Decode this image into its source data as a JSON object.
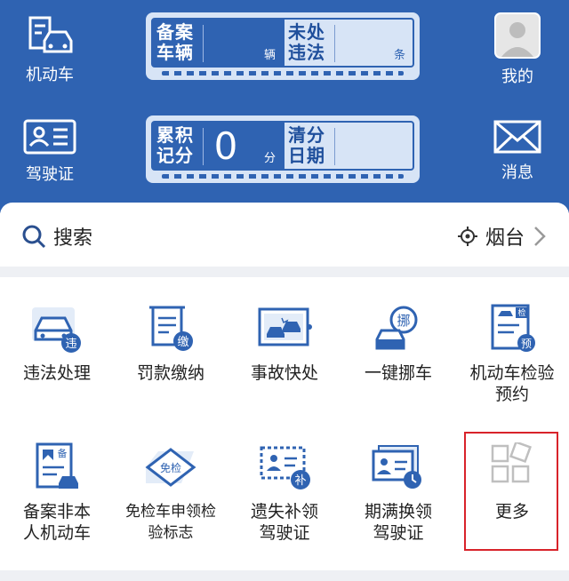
{
  "header": {
    "vehicle_label": "机动车",
    "license_label": "驾驶证",
    "mine_label": "我的",
    "messages_label": "消息",
    "card1": {
      "registered_title": "备案\n车辆",
      "registered_unit": "辆",
      "violations_title": "未处\n违法",
      "violations_unit": "条"
    },
    "card2": {
      "points_title": "累积\n记分",
      "points_value": "0",
      "points_unit": "分",
      "clear_title": "清分\n日期"
    }
  },
  "search": {
    "label": "搜索",
    "city": "烟台"
  },
  "services": [
    {
      "label": "违法处理",
      "badge": "违"
    },
    {
      "label": "罚款缴纳",
      "badge": "缴"
    },
    {
      "label": "事故快处"
    },
    {
      "label": "一键挪车",
      "badge": "挪"
    },
    {
      "label": "机动车检验预约",
      "badge": "预",
      "tag": "检"
    },
    {
      "label": "备案非本人机动车",
      "tag": "备"
    },
    {
      "label": "免检车申领检验标志",
      "tag": "免检"
    },
    {
      "label": "遗失补领驾驶证",
      "badge": "补"
    },
    {
      "label": "期满换领驾驶证"
    },
    {
      "label": "更多"
    }
  ],
  "colors": {
    "header_bg": "#2f63b2",
    "card_bg": "#d7e4f6",
    "icon_blue": "#2f63b2",
    "highlight_border": "#d8232a"
  }
}
